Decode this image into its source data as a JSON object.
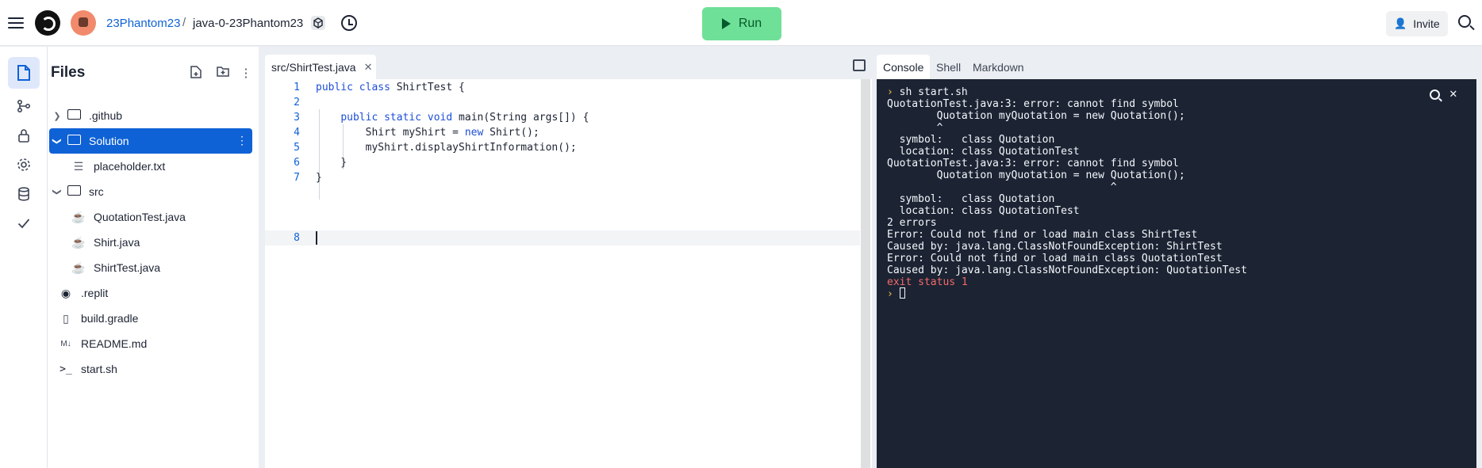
{
  "topbar": {
    "username": "23Phantom23",
    "separator": "/",
    "repl_name": "java-0-23Phantom23",
    "run_label": "Run",
    "invite_label": "Invite"
  },
  "files": {
    "title": "Files",
    "tree": [
      {
        "name": ".github",
        "type": "folder",
        "expanded": false,
        "depth": 0
      },
      {
        "name": "Solution",
        "type": "folder",
        "expanded": true,
        "depth": 0,
        "selected": true
      },
      {
        "name": "placeholder.txt",
        "type": "text",
        "depth": 1
      },
      {
        "name": "src",
        "type": "folder",
        "expanded": true,
        "depth": 0
      },
      {
        "name": "QuotationTest.java",
        "type": "java",
        "depth": 1
      },
      {
        "name": "Shirt.java",
        "type": "java",
        "depth": 1
      },
      {
        "name": "ShirtTest.java",
        "type": "java",
        "depth": 1
      },
      {
        "name": ".replit",
        "type": "replit",
        "depth": 0
      },
      {
        "name": "build.gradle",
        "type": "file",
        "depth": 0
      },
      {
        "name": "README.md",
        "type": "markdown",
        "depth": 0
      },
      {
        "name": "start.sh",
        "type": "shell",
        "depth": 0
      }
    ]
  },
  "editor": {
    "tab_label": "src/ShirtTest.java",
    "lines": [
      {
        "n": "1",
        "text": "public class ShirtTest {"
      },
      {
        "n": "2",
        "text": ""
      },
      {
        "n": "3",
        "text": "    public static void main(String args[]) {"
      },
      {
        "n": "4",
        "text": "        Shirt myShirt = new Shirt();"
      },
      {
        "n": "5",
        "text": "        myShirt.displayShirtInformation();"
      },
      {
        "n": "6",
        "text": "    }"
      },
      {
        "n": "7",
        "text": "}"
      },
      {
        "n": "8",
        "text": ""
      }
    ]
  },
  "console": {
    "tabs": [
      "Console",
      "Shell",
      "Markdown"
    ],
    "active_tab": "Console",
    "output": [
      {
        "text": "sh start.sh",
        "kind": "command"
      },
      {
        "text": "QuotationTest.java:3: error: cannot find symbol",
        "kind": "out"
      },
      {
        "text": "        Quotation myQuotation = new Quotation();",
        "kind": "out"
      },
      {
        "text": "        ^",
        "kind": "out"
      },
      {
        "text": "  symbol:   class Quotation",
        "kind": "out"
      },
      {
        "text": "  location: class QuotationTest",
        "kind": "out"
      },
      {
        "text": "QuotationTest.java:3: error: cannot find symbol",
        "kind": "out"
      },
      {
        "text": "        Quotation myQuotation = new Quotation();",
        "kind": "out"
      },
      {
        "text": "                                    ^",
        "kind": "out"
      },
      {
        "text": "  symbol:   class Quotation",
        "kind": "out"
      },
      {
        "text": "  location: class QuotationTest",
        "kind": "out"
      },
      {
        "text": "2 errors",
        "kind": "out"
      },
      {
        "text": "Error: Could not find or load main class ShirtTest",
        "kind": "out"
      },
      {
        "text": "Caused by: java.lang.ClassNotFoundException: ShirtTest",
        "kind": "out"
      },
      {
        "text": "Error: Could not find or load main class QuotationTest",
        "kind": "out"
      },
      {
        "text": "Caused by: java.lang.ClassNotFoundException: QuotationTest",
        "kind": "out"
      },
      {
        "text": "exit status 1",
        "kind": "error"
      },
      {
        "text": "",
        "kind": "prompt"
      }
    ]
  },
  "colors": {
    "accent": "#0f62d6",
    "run_button": "#6fe097",
    "terminal_bg": "#1c2333",
    "error_text": "#f26a6a",
    "prompt_glyph": "#f4c542"
  }
}
